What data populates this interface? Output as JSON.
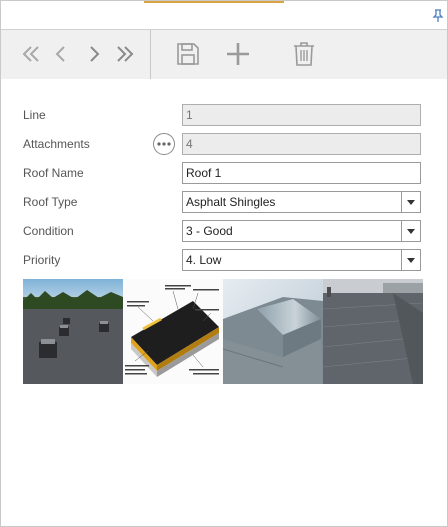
{
  "toolbar": {
    "first_icon": "double-chevron-left-icon",
    "prev_icon": "chevron-left-icon",
    "next_icon": "chevron-right-icon",
    "last_icon": "double-chevron-right-icon",
    "save_icon": "save-icon",
    "add_icon": "plus-icon",
    "delete_icon": "trash-icon"
  },
  "form": {
    "line": {
      "label": "Line",
      "value": "1"
    },
    "attachments": {
      "label": "Attachments",
      "value": "4"
    },
    "roof_name": {
      "label": "Roof Name",
      "value": "Roof 1"
    },
    "roof_type": {
      "label": "Roof Type",
      "value": "Asphalt Shingles"
    },
    "condition": {
      "label": "Condition",
      "value": "3 - Good"
    },
    "priority": {
      "label": "Priority",
      "value": "4. Low"
    }
  },
  "photos": [
    {
      "name": "flat-roof-with-hvac-units-photo"
    },
    {
      "name": "roof-membrane-diagram-photo"
    },
    {
      "name": "metal-roof-edge-photo"
    },
    {
      "name": "gray-roof-surface-photo"
    }
  ],
  "colors": {
    "accent": "#d9a441",
    "toolbar_bg": "#f0f0f0",
    "icon_gray": "#9a9a9a",
    "readonly_bg": "#ececec"
  }
}
